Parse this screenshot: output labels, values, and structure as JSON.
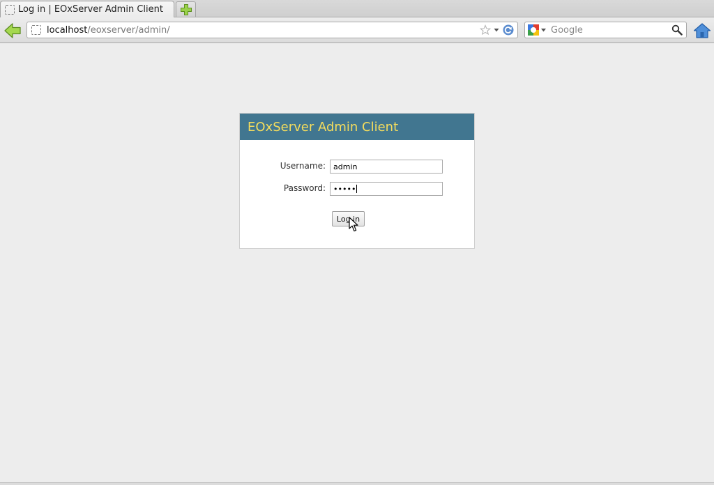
{
  "browser": {
    "tab_title": "Log in | EOxServer Admin Client",
    "url_host": "localhost",
    "url_path": "/eoxserver/admin/",
    "search_placeholder": "Google"
  },
  "login": {
    "header_title": "EOxServer Admin Client",
    "username_label": "Username:",
    "username_value": "admin",
    "password_label": "Password:",
    "password_masked": "•••••",
    "submit_label": "Log in"
  },
  "colors": {
    "header_bg": "#417690",
    "header_text": "#f5dd5d"
  },
  "icons": {
    "back": "back-arrow-icon",
    "new_tab": "plus-icon",
    "bookmark": "star-icon",
    "reload": "reload-icon",
    "search": "magnifier-icon",
    "home": "home-icon"
  }
}
